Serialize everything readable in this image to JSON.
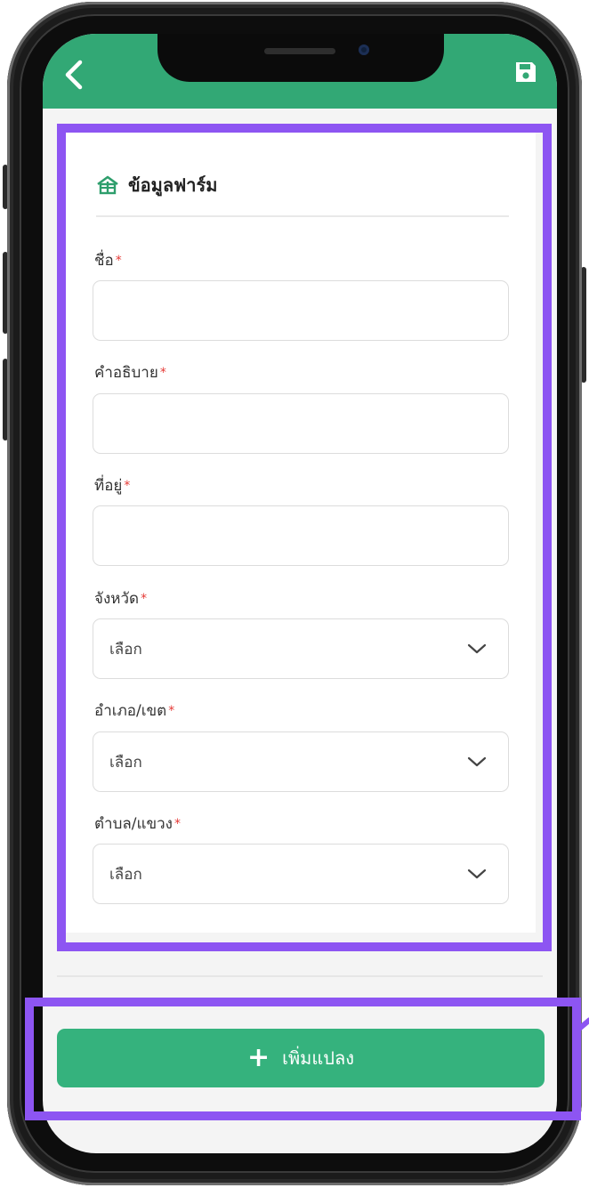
{
  "header": {
    "title": ""
  },
  "section": {
    "title": "ข้อมูลฟาร์ม",
    "icon": "farm-icon"
  },
  "fields": {
    "name": {
      "label": "ชื่อ",
      "required_mark": "*",
      "value": ""
    },
    "description": {
      "label": "คำอธิบาย",
      "required_mark": "*",
      "value": ""
    },
    "address": {
      "label": "ที่อยู่",
      "required_mark": "*",
      "value": ""
    },
    "province": {
      "label": "จังหวัด",
      "required_mark": "*",
      "selected": "เลือก"
    },
    "district": {
      "label": "อำเภอ/เขต",
      "required_mark": "*",
      "selected": "เลือก"
    },
    "subdistrict": {
      "label": "ตำบล/แขวง",
      "required_mark": "*",
      "selected": "เลือก"
    }
  },
  "footer": {
    "add_plot_label": "เพิ่มแปลง",
    "add_icon": "+"
  },
  "colors": {
    "header": "#32a875",
    "button": "#35b27d",
    "highlight": "#8d55f2",
    "required": "#e53935"
  },
  "icons": [
    "back-icon",
    "save-icon",
    "farm-icon",
    "chevron-down-icon",
    "plus-icon"
  ]
}
